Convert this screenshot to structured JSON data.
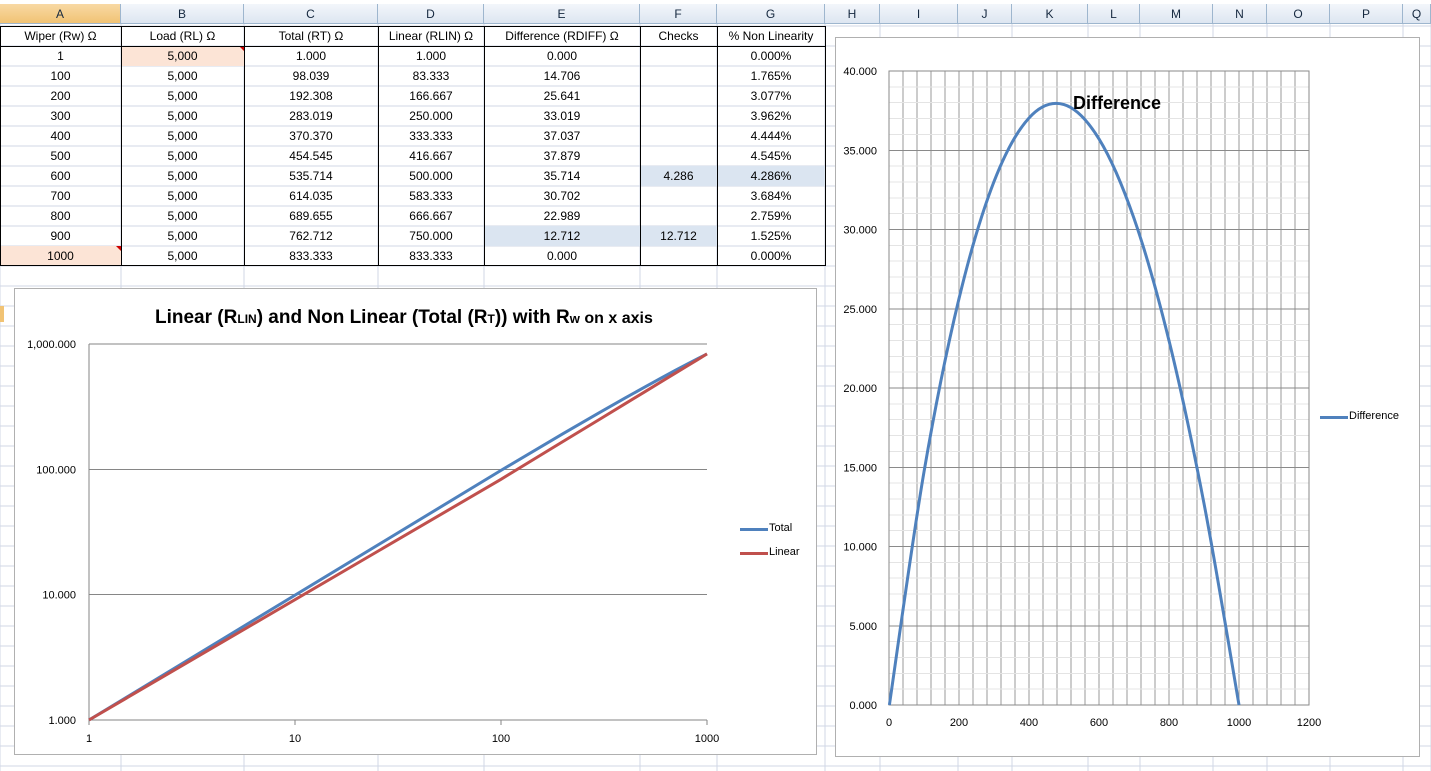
{
  "sheet": {
    "columns": [
      "A",
      "B",
      "C",
      "D",
      "E",
      "F",
      "G",
      "H",
      "I",
      "J",
      "K",
      "L",
      "M",
      "N",
      "O",
      "P",
      "Q"
    ],
    "headers": {
      "wiper": "Wiper (Rw) Ω",
      "load": "Load (RL) Ω",
      "total": "Total (RT) Ω",
      "linear": "Linear (RLIN) Ω",
      "difference": "Difference (RDIFF) Ω",
      "checks": "Checks",
      "nonlin": "% Non Linearity"
    },
    "rows": [
      {
        "wiper": "1",
        "load": "5,000",
        "total": "1.000",
        "linear": "1.000",
        "diff": "0.000",
        "check": "",
        "nonlin": "0.000%"
      },
      {
        "wiper": "100",
        "load": "5,000",
        "total": "98.039",
        "linear": "83.333",
        "diff": "14.706",
        "check": "",
        "nonlin": "1.765%"
      },
      {
        "wiper": "200",
        "load": "5,000",
        "total": "192.308",
        "linear": "166.667",
        "diff": "25.641",
        "check": "",
        "nonlin": "3.077%"
      },
      {
        "wiper": "300",
        "load": "5,000",
        "total": "283.019",
        "linear": "250.000",
        "diff": "33.019",
        "check": "",
        "nonlin": "3.962%"
      },
      {
        "wiper": "400",
        "load": "5,000",
        "total": "370.370",
        "linear": "333.333",
        "diff": "37.037",
        "check": "",
        "nonlin": "4.444%"
      },
      {
        "wiper": "500",
        "load": "5,000",
        "total": "454.545",
        "linear": "416.667",
        "diff": "37.879",
        "check": "",
        "nonlin": "4.545%"
      },
      {
        "wiper": "600",
        "load": "5,000",
        "total": "535.714",
        "linear": "500.000",
        "diff": "35.714",
        "check": "4.286",
        "nonlin": "4.286%"
      },
      {
        "wiper": "700",
        "load": "5,000",
        "total": "614.035",
        "linear": "583.333",
        "diff": "30.702",
        "check": "",
        "nonlin": "3.684%"
      },
      {
        "wiper": "800",
        "load": "5,000",
        "total": "689.655",
        "linear": "666.667",
        "diff": "22.989",
        "check": "",
        "nonlin": "2.759%"
      },
      {
        "wiper": "900",
        "load": "5,000",
        "total": "762.712",
        "linear": "750.000",
        "diff": "12.712",
        "check": "12.712",
        "nonlin": "1.525%"
      },
      {
        "wiper": "1000",
        "load": "5,000",
        "total": "833.333",
        "linear": "833.333",
        "diff": "0.000",
        "check": "",
        "nonlin": "0.000%"
      }
    ],
    "colors": {
      "highlight_peach": "#fce4d6",
      "highlight_blue": "#dbe5f1",
      "comment_marker": "#cc0000"
    }
  },
  "chart_data": [
    {
      "type": "line",
      "title_parts": [
        "Linear (R",
        "LIN",
        ") and Non Linear (Total (R",
        "T",
        ")) with R",
        "w",
        " on x axis"
      ],
      "xscale": "log",
      "yscale": "log",
      "xlim": [
        1,
        1000
      ],
      "ylim": [
        1,
        1000
      ],
      "xticks": [
        "1",
        "10",
        "100",
        "1000"
      ],
      "yticks": [
        "1.000",
        "10.000",
        "100.000",
        "1,000.000"
      ],
      "x": [
        1,
        100,
        200,
        300,
        400,
        500,
        600,
        700,
        800,
        900,
        1000
      ],
      "series": [
        {
          "name": "Total",
          "color": "#4f81bd",
          "values": [
            1.0,
            98.039,
            192.308,
            283.019,
            370.37,
            454.545,
            535.714,
            614.035,
            689.655,
            762.712,
            833.333
          ]
        },
        {
          "name": "Linear",
          "color": "#c0504d",
          "values": [
            1.0,
            83.333,
            166.667,
            250.0,
            333.333,
            416.667,
            500.0,
            583.333,
            666.667,
            750.0,
            833.333
          ]
        }
      ],
      "grid": "horizontal major",
      "legend": "right"
    },
    {
      "type": "scatter",
      "title": "Difference",
      "xlim": [
        0,
        1200
      ],
      "ylim": [
        0,
        40
      ],
      "xticks": [
        "0",
        "200",
        "400",
        "600",
        "800",
        "1000",
        "1200"
      ],
      "yticks": [
        "0.000",
        "5.000",
        "10.000",
        "15.000",
        "20.000",
        "25.000",
        "30.000",
        "35.000",
        "40.000"
      ],
      "x": [
        1,
        100,
        200,
        300,
        400,
        500,
        600,
        700,
        800,
        900,
        1000
      ],
      "series": [
        {
          "name": "Difference",
          "color": "#4f81bd",
          "values": [
            0.0,
            14.706,
            25.641,
            33.019,
            37.037,
            37.879,
            35.714,
            30.702,
            22.989,
            12.712,
            0.0
          ]
        }
      ],
      "grid": "major and minor",
      "legend": "right"
    }
  ]
}
